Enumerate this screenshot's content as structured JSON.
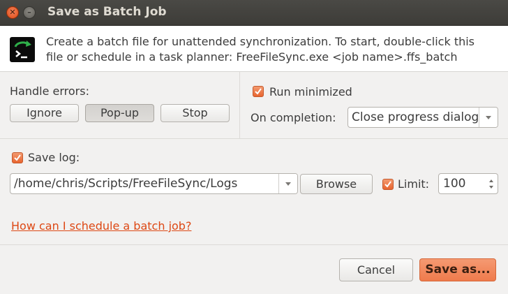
{
  "window": {
    "title": "Save as Batch Job",
    "controls": {
      "close_icon": "close-icon",
      "minimize_icon": "minimize-icon"
    }
  },
  "header": {
    "icon": "terminal-sync-icon",
    "line1": "Create a batch file for unattended synchronization. To start, double-click this",
    "line2": "file or schedule in a task planner: FreeFileSync.exe <job name>.ffs_batch"
  },
  "errors": {
    "label": "Handle errors:",
    "buttons": [
      "Ignore",
      "Pop-up",
      "Stop"
    ],
    "selected": "Pop-up"
  },
  "options": {
    "run_minimized": {
      "label": "Run minimized",
      "checked": true
    },
    "on_completion": {
      "label": "On completion:",
      "value": "Close progress dialog"
    }
  },
  "log": {
    "save_log": {
      "label": "Save log:",
      "checked": true
    },
    "path": "/home/chris/Scripts/FreeFileSync/Logs",
    "browse_label": "Browse",
    "limit": {
      "label": "Limit:",
      "checked": true,
      "value": "100"
    }
  },
  "help_link": "How can I schedule a batch job?",
  "footer": {
    "cancel_label": "Cancel",
    "save_label": "Save as..."
  },
  "colors": {
    "accent": "#ef7b4c",
    "link": "#dd4814",
    "titlebar": "#3d3c38"
  }
}
